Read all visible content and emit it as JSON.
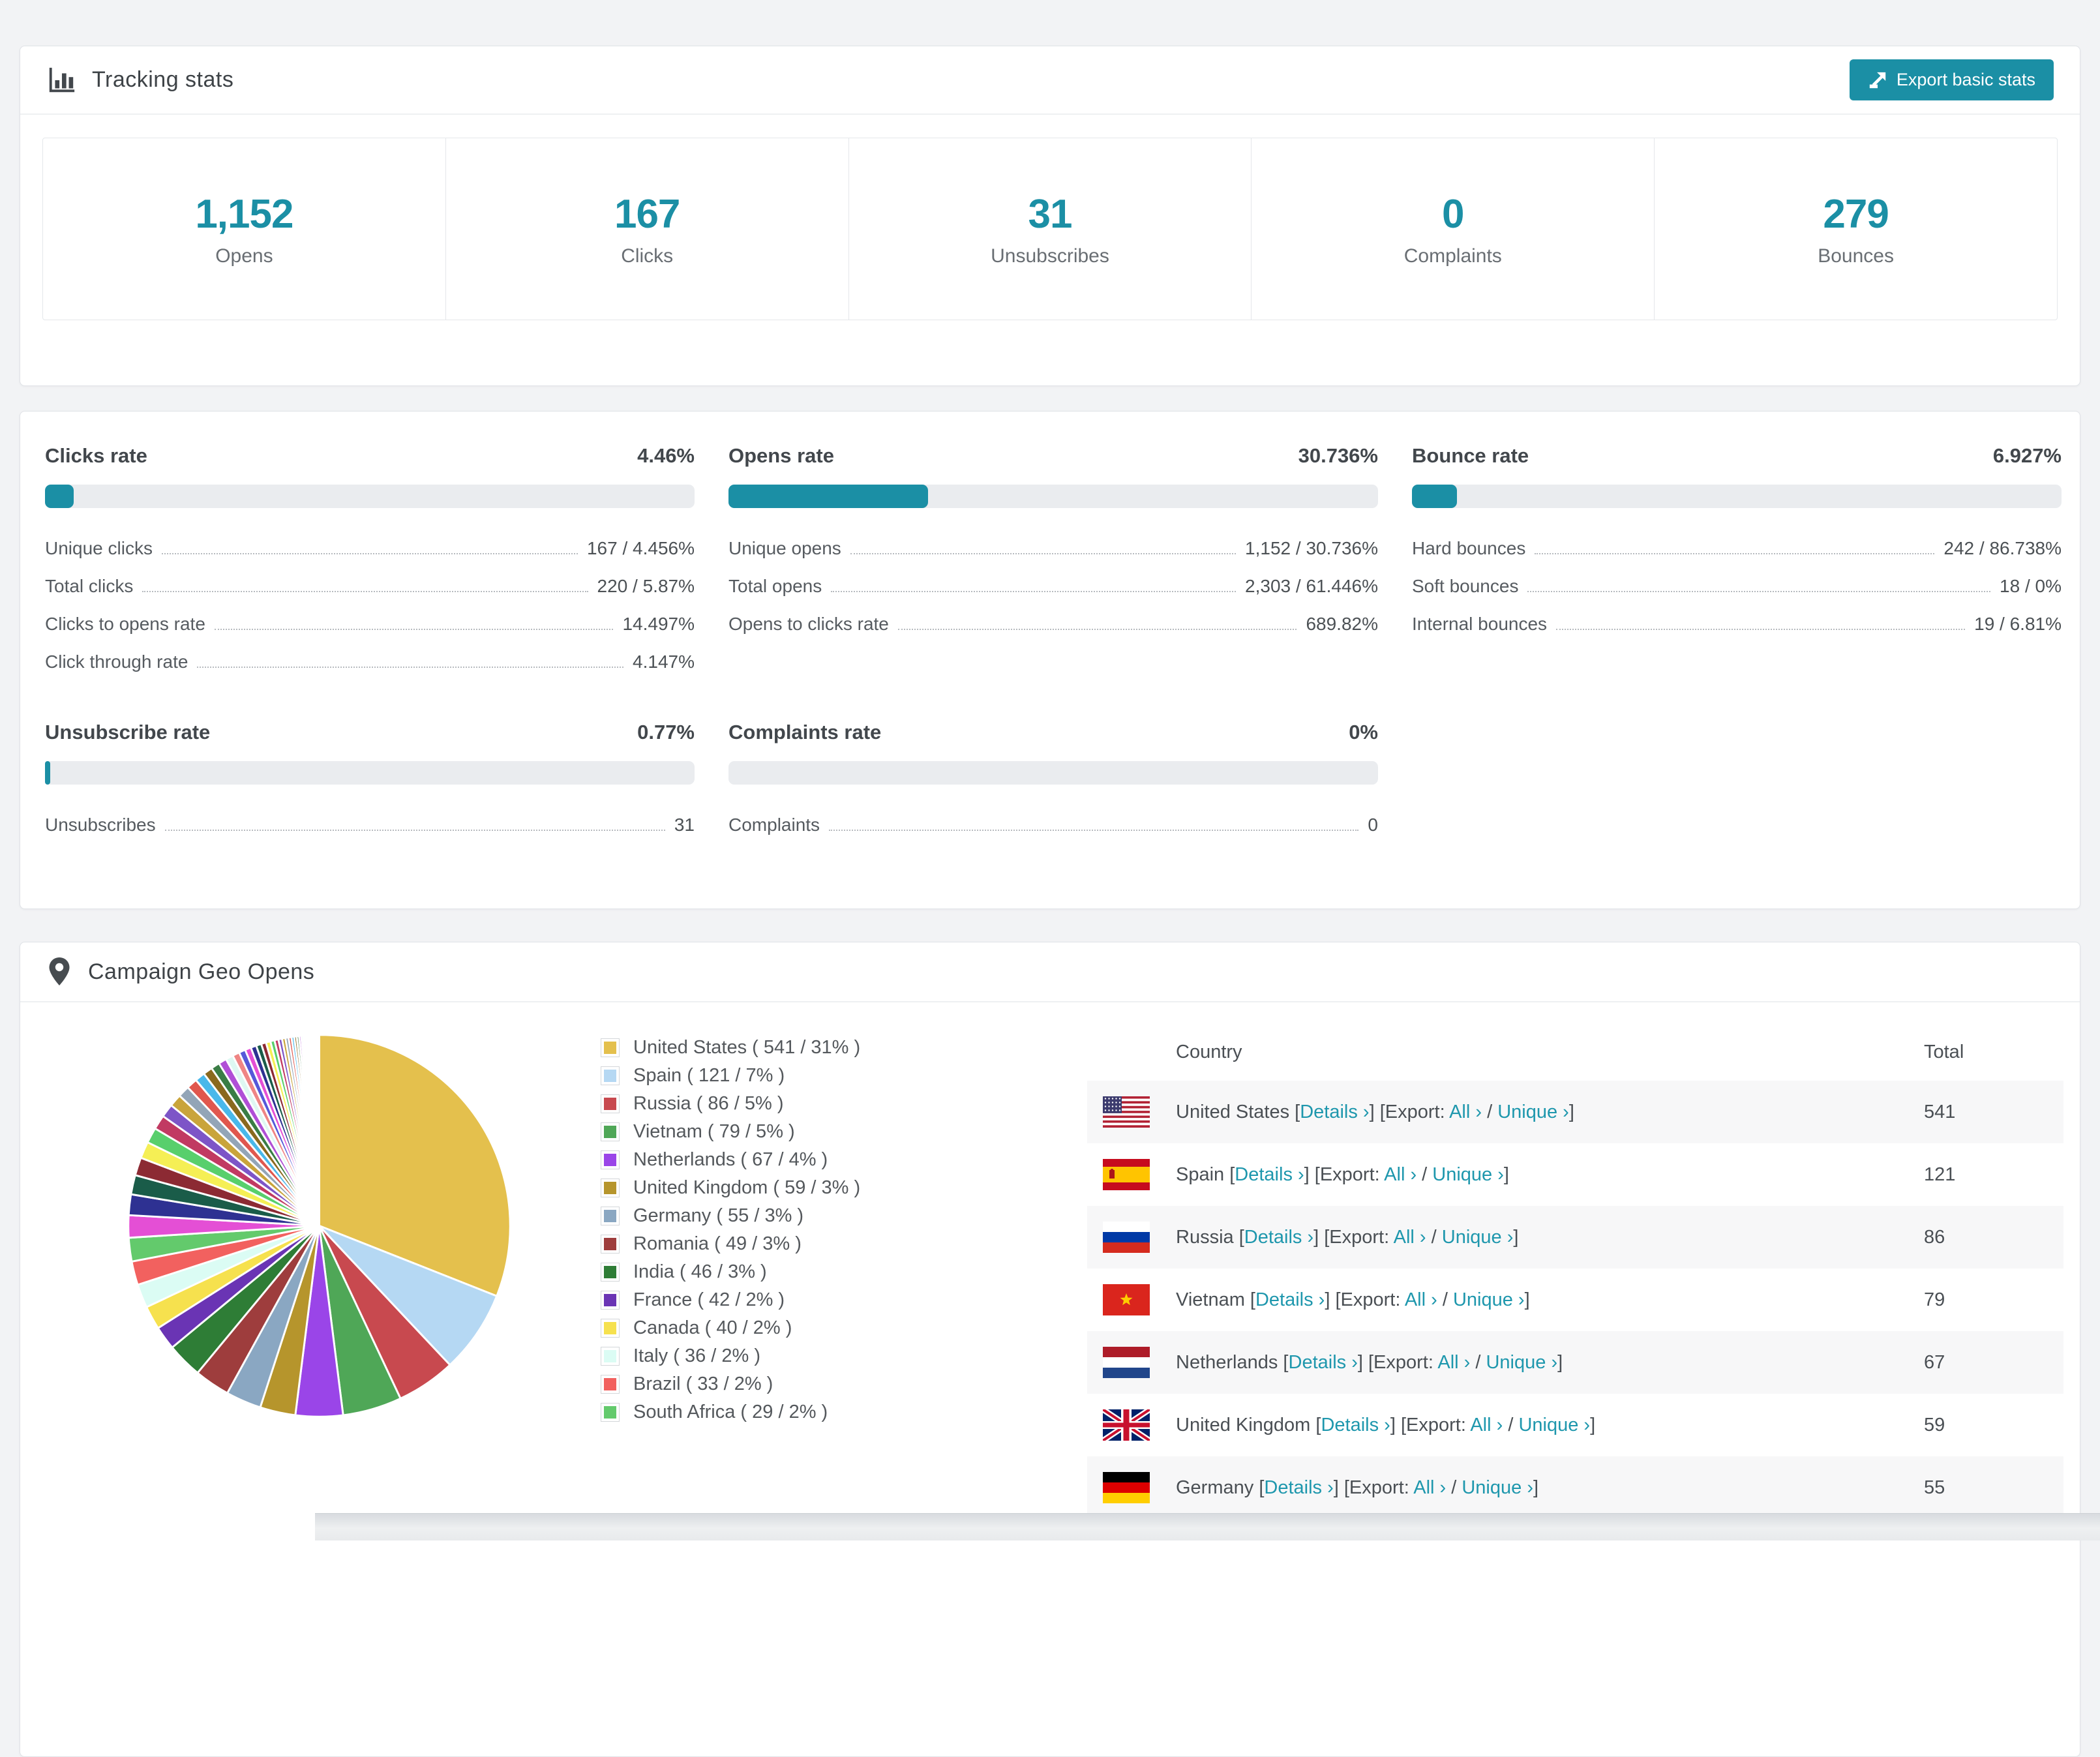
{
  "colors": {
    "accent": "#1b8fa5",
    "link": "#1e97ad"
  },
  "tracking": {
    "title": "Tracking stats",
    "export_label": "Export basic stats"
  },
  "summary": [
    {
      "value": "1,152",
      "label": "Opens"
    },
    {
      "value": "167",
      "label": "Clicks"
    },
    {
      "value": "31",
      "label": "Unsubscribes"
    },
    {
      "value": "0",
      "label": "Complaints"
    },
    {
      "value": "279",
      "label": "Bounces"
    }
  ],
  "rates": [
    {
      "title": "Clicks rate",
      "display": "4.46%",
      "percent": 4.46,
      "rows": [
        [
          "Unique clicks",
          "167 / 4.456%"
        ],
        [
          "Total clicks",
          "220 / 5.87%"
        ],
        [
          "Clicks to opens rate",
          "14.497%"
        ],
        [
          "Click through rate",
          "4.147%"
        ]
      ]
    },
    {
      "title": "Opens rate",
      "display": "30.736%",
      "percent": 30.736,
      "rows": [
        [
          "Unique opens",
          "1,152 / 30.736%"
        ],
        [
          "Total opens",
          "2,303 / 61.446%"
        ],
        [
          "Opens to clicks rate",
          "689.82%"
        ]
      ]
    },
    {
      "title": "Bounce rate",
      "display": "6.927%",
      "percent": 6.927,
      "rows": [
        [
          "Hard bounces",
          "242 / 86.738%"
        ],
        [
          "Soft bounces",
          "18 / 0%"
        ],
        [
          "Internal bounces",
          "19 / 6.81%"
        ]
      ]
    },
    {
      "title": "Unsubscribe rate",
      "display": "0.77%",
      "percent": 0.77,
      "rows": [
        [
          "Unsubscribes",
          "31"
        ]
      ]
    },
    {
      "title": "Complaints rate",
      "display": "0%",
      "percent": 0,
      "rows": [
        [
          "Complaints",
          "0"
        ]
      ]
    }
  ],
  "geo": {
    "title": "Campaign Geo Opens",
    "table_headers": [
      "Country",
      "Total"
    ],
    "links": {
      "details": "Details",
      "export_prefix": "Export:",
      "all": "All",
      "unique": "Unique",
      "arrow": "›"
    },
    "rows": [
      {
        "country": "United States",
        "total": "541",
        "flag": "us"
      },
      {
        "country": "Spain",
        "total": "121",
        "flag": "es"
      },
      {
        "country": "Russia",
        "total": "86",
        "flag": "ru"
      },
      {
        "country": "Vietnam",
        "total": "79",
        "flag": "vn"
      },
      {
        "country": "Netherlands",
        "total": "67",
        "flag": "nl"
      },
      {
        "country": "United Kingdom",
        "total": "59",
        "flag": "gb"
      },
      {
        "country": "Germany",
        "total": "55",
        "flag": "de"
      }
    ],
    "chart_data": {
      "type": "pie",
      "title": "Campaign Geo Opens",
      "unit": "opens",
      "start_angle": "top",
      "direction": "clockwise",
      "legend_position": "right",
      "series": [
        {
          "name": "United States",
          "value": 541,
          "pct": 31,
          "color": "#e4c04d"
        },
        {
          "name": "Spain",
          "value": 121,
          "pct": 7,
          "color": "#b5d8f3"
        },
        {
          "name": "Russia",
          "value": 86,
          "pct": 5,
          "color": "#c8494f"
        },
        {
          "name": "Vietnam",
          "value": 79,
          "pct": 5,
          "color": "#4fa757"
        },
        {
          "name": "Netherlands",
          "value": 67,
          "pct": 4,
          "color": "#9a45e8"
        },
        {
          "name": "United Kingdom",
          "value": 59,
          "pct": 3,
          "color": "#b6952c"
        },
        {
          "name": "Germany",
          "value": 55,
          "pct": 3,
          "color": "#8aa7c2"
        },
        {
          "name": "Romania",
          "value": 49,
          "pct": 3,
          "color": "#9e3d3d"
        },
        {
          "name": "India",
          "value": 46,
          "pct": 3,
          "color": "#2e7d36"
        },
        {
          "name": "France",
          "value": 42,
          "pct": 2,
          "color": "#6a34b4"
        },
        {
          "name": "Canada",
          "value": 40,
          "pct": 2,
          "color": "#f6e14e"
        },
        {
          "name": "Italy",
          "value": 36,
          "pct": 2,
          "color": "#dbfcf4"
        },
        {
          "name": "Brazil",
          "value": 33,
          "pct": 2,
          "color": "#f2615f"
        },
        {
          "name": "South Africa",
          "value": 29,
          "pct": 2,
          "color": "#63ca6c"
        }
      ],
      "others_total_pct": 26,
      "other_colors": [
        "#e44fd5",
        "#2e3192",
        "#1a5c49",
        "#8c2a33",
        "#f5ef55",
        "#58cf6c",
        "#c13a62",
        "#7d55c7",
        "#c9a43b",
        "#93a5b7",
        "#e0574e",
        "#49b8ea",
        "#8a691e",
        "#3a7d45",
        "#b04fd6",
        "#def8f2",
        "#ef8584",
        "#5558d9"
      ]
    }
  }
}
